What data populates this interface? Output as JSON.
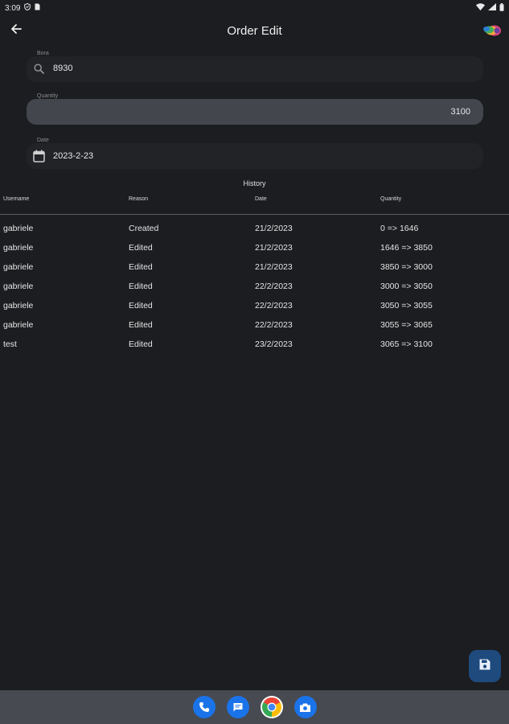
{
  "status": {
    "time": "3:09"
  },
  "header": {
    "title": "Order Edit"
  },
  "fields": {
    "bora": {
      "label": "Bora",
      "value": "8930"
    },
    "quantity": {
      "label": "Quantity",
      "value": "3100"
    },
    "date": {
      "label": "Date",
      "value": "2023-2-23"
    }
  },
  "history": {
    "title": "History",
    "columns": [
      "Username",
      "Reason",
      "Date",
      "Quantity"
    ],
    "rows": [
      [
        "gabriele",
        "Created",
        "21/2/2023",
        "0 => 1646"
      ],
      [
        "gabriele",
        "Edited",
        "21/2/2023",
        "1646 => 3850"
      ],
      [
        "gabriele",
        "Edited",
        "21/2/2023",
        "3850 => 3000"
      ],
      [
        "gabriele",
        "Edited",
        "22/2/2023",
        "3000 => 3050"
      ],
      [
        "gabriele",
        "Edited",
        "22/2/2023",
        "3050 => 3055"
      ],
      [
        "gabriele",
        "Edited",
        "22/2/2023",
        "3055 => 3065"
      ],
      [
        "test",
        "Edited",
        "23/2/2023",
        "3065 => 3100"
      ]
    ]
  },
  "icons": {
    "back": "arrow-left-icon",
    "search": "search-icon",
    "calendar": "calendar-icon",
    "save": "save-icon",
    "dock": [
      "phone-icon",
      "messages-icon",
      "chrome-icon",
      "camera-icon"
    ]
  },
  "colors": {
    "background": "#1c1d20",
    "fab": "#1e4a7e",
    "dock": "#1a73e8"
  }
}
